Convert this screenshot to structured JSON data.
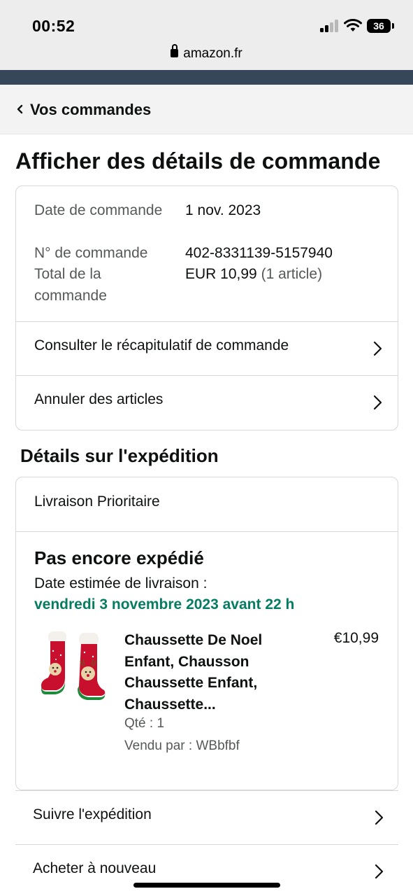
{
  "status_bar": {
    "time": "00:52",
    "battery": "36"
  },
  "browser": {
    "url": "amazon.fr"
  },
  "nav": {
    "back_label": "Vos commandes"
  },
  "page": {
    "title": "Afficher des détails de commande"
  },
  "order": {
    "date_label": "Date de commande",
    "date_value": "1 nov. 2023",
    "number_label": "N° de commande",
    "number_value": "402-8331139-5157940",
    "total_label": "Total de la commande",
    "total_value": "EUR 10,99",
    "total_items": "(1 article)",
    "actions": [
      {
        "label": "Consulter le récapitulatif de commande"
      },
      {
        "label": "Annuler des articles"
      }
    ]
  },
  "shipping": {
    "section_title": "Détails sur l'expédition",
    "type": "Livraison Prioritaire",
    "status": "Pas encore expédié",
    "estimate_label": "Date estimée de livraison :",
    "estimate_date": "vendredi 3 novembre 2023 avant 22 h",
    "product": {
      "title_lines": [
        "Chaussette De Noel",
        "Enfant, Chausson",
        "Chaussette Enfant,",
        "Chaussette..."
      ],
      "price": "€10,99",
      "qty": "Qté : 1",
      "seller": "Vendu par : WBbfbf",
      "image": "christmas-socks-image"
    },
    "actions": [
      {
        "label": "Suivre l'expédition"
      },
      {
        "label": "Acheter à nouveau"
      }
    ]
  },
  "icons": {
    "lock": "lock-icon",
    "back": "chevron-left-icon",
    "row": "chevron-right-icon",
    "signal": "cellular-signal-icon",
    "wifi": "wifi-icon",
    "battery": "battery-icon"
  },
  "colors": {
    "delivery_green": "#067d62",
    "nav_strip": "#37475a",
    "border": "#d5d9d9",
    "muted_text": "#565959"
  }
}
